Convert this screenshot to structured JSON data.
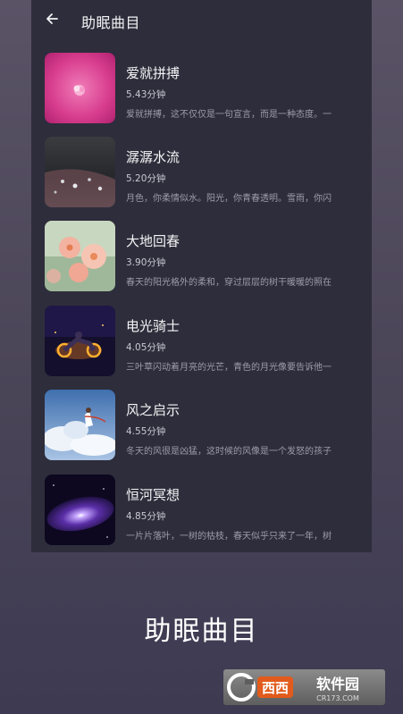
{
  "header": {
    "title": "助眠曲目",
    "back_icon": "arrow-left-icon"
  },
  "tracks": [
    {
      "name": "爱就拼搏",
      "duration": "5.43分钟",
      "desc": "爱就拼搏，这不仅仅是一句宣言，而是一种态度。一"
    },
    {
      "name": "潺潺水流",
      "duration": "5.20分钟",
      "desc": "月色，你柔情似水。阳光，你青春透明。雪雨，你闪"
    },
    {
      "name": "大地回春",
      "duration": "3.90分钟",
      "desc": "春天的阳光格外的柔和，穿过层层的树干暖暖的照在"
    },
    {
      "name": "电光骑士",
      "duration": "4.05分钟",
      "desc": "三叶草闪动着月亮的光芒，青色的月光像要告诉他一"
    },
    {
      "name": "风之启示",
      "duration": "4.55分钟",
      "desc": "冬天的风很是凶猛，这时候的风像是一个发怒的孩子"
    },
    {
      "name": "恒河冥想",
      "duration": "4.85分钟",
      "desc": "一片片落叶，一树的枯枝，春天似乎只来了一年，树"
    }
  ],
  "caption": "助眠曲目",
  "watermark": {
    "logo_text": "西西软件园",
    "domain": "CR173.COM"
  },
  "colors": {
    "panel": "#2e2d3b",
    "background": "#4d475a",
    "text_primary": "#f4f4f6",
    "text_secondary": "#9d9caa"
  }
}
